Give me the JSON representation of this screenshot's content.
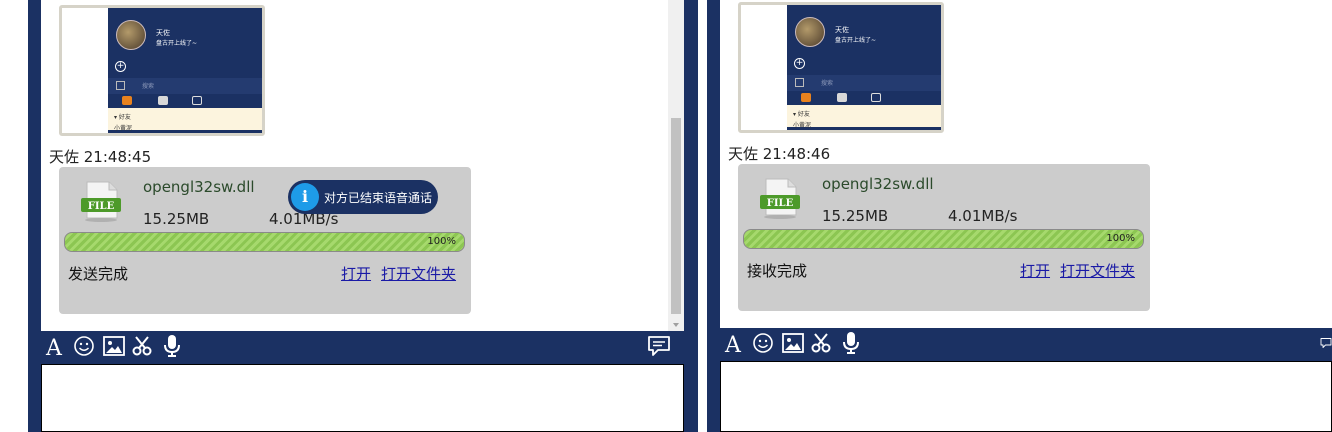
{
  "left_window": {
    "thumbnail": {
      "mini_name": "天佐",
      "mini_signature": "盘古开上线了~",
      "mini_search_placeholder": "搜索",
      "mini_group_label": "好友",
      "mini_row_label": "小黄泥"
    },
    "sender_line": "天佐 21:48:45",
    "file": {
      "icon_label": "FILE",
      "name": "opengl32sw.dll",
      "size": "15.25MB",
      "speed": "4.01MB/s",
      "progress_percent": 100,
      "progress_label": "100%",
      "status": "发送完成",
      "open_link": "打开",
      "open_folder_link": "打开文件夹"
    },
    "toast": {
      "icon": "i",
      "text": "对方已结束语音通话"
    }
  },
  "right_window": {
    "thumbnail": {
      "mini_name": "天佐",
      "mini_signature": "盘古开上线了~",
      "mini_search_placeholder": "搜索",
      "mini_group_label": "好友",
      "mini_row_label": "小黄泥"
    },
    "sender_line": "天佐 21:48:46",
    "file": {
      "icon_label": "FILE",
      "name": "opengl32sw.dll",
      "size": "15.25MB",
      "speed": "4.01MB/s",
      "progress_percent": 100,
      "progress_label": "100%",
      "status": "接收完成",
      "open_link": "打开",
      "open_folder_link": "打开文件夹"
    }
  },
  "toolbar_icons": [
    "font-icon",
    "emoji-icon",
    "image-icon",
    "scissors-icon",
    "microphone-icon"
  ],
  "colors": {
    "frame": "#1b3163",
    "card": "#cccccc",
    "progress": "#9cd05e",
    "link": "#1a1aa6",
    "toast_icon": "#1e9be8"
  }
}
